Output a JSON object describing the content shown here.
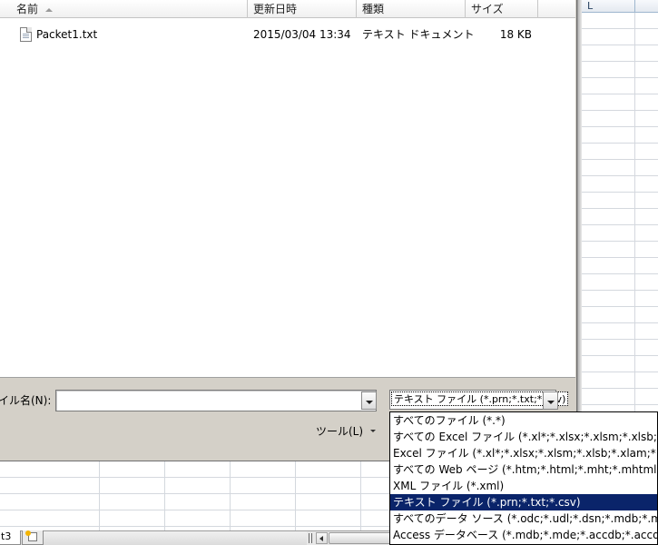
{
  "columns": {
    "name": "名前",
    "modified": "更新日時",
    "type": "種類",
    "size": "サイズ"
  },
  "files": [
    {
      "name": "Packet1.txt",
      "modified": "2015/03/04 13:34",
      "type": "テキスト ドキュメント",
      "size": "18 KB"
    }
  ],
  "filename": {
    "label": "イル名(N):",
    "value": ""
  },
  "filetype": {
    "selected": "テキスト ファイル (*.prn;*.txt;*.csv)",
    "options": [
      "すべてのファイル (*.*)",
      "すべての Excel ファイル (*.xl*;*.xlsx;*.xlsm;*.xlsb;*.xlam;*.xltx;*.xltm",
      "Excel ファイル (*.xl*;*.xlsx;*.xlsm;*.xlsb;*.xlam;*.xltx;*.xltm;*.xls",
      "すべての Web ページ (*.htm;*.html;*.mht;*.mhtml)",
      "XML ファイル (*.xml)",
      "テキスト ファイル (*.prn;*.txt;*.csv)",
      "すべてのデータ ソース (*.odc;*.udl;*.dsn;*.mdb;*.mde;*.accdb",
      "Access データベース (*.mdb;*.mde;*.accdb;*.accde)"
    ],
    "selected_index": 5
  },
  "tools": {
    "label": "ツール(L)"
  },
  "excel": {
    "column_letter": "L",
    "sheet_tab": "t3"
  },
  "colors": {
    "dialog_bg": "#d4d0c8",
    "highlight": "#0a246a"
  }
}
